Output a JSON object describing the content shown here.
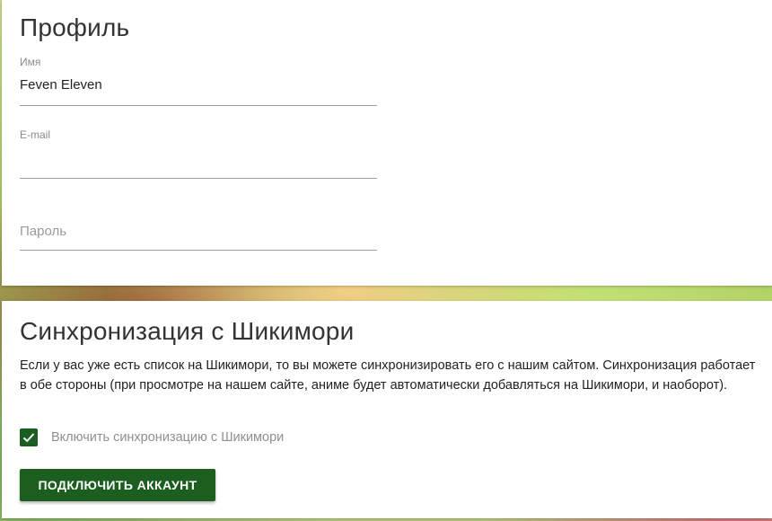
{
  "profile": {
    "title": "Профиль",
    "name_label": "Имя",
    "name_value": "Feven Eleven",
    "email_label": "E-mail",
    "email_value": "",
    "password_placeholder": "Пароль"
  },
  "sync": {
    "title": "Синхронизация с Шикимори",
    "description": "Если у вас уже есть список на Шикимори, то вы можете синхронизировать его с нашим сайтом. Синхронизация работает в обе стороны (при просмотре на нашем сайте, аниме будет автоматически добавляться на Шикимори, и наоборот).",
    "checkbox_label": "Включить синхронизацию с Шикимори",
    "checkbox_checked": true,
    "button_label": "ПОДКЛЮЧИТЬ АККАУНТ"
  },
  "colors": {
    "accent": "#1b5e20",
    "underline": "#9e9e9e",
    "muted_text": "#8f8f8f"
  },
  "icons": {
    "checkbox_mark": "check-icon"
  }
}
